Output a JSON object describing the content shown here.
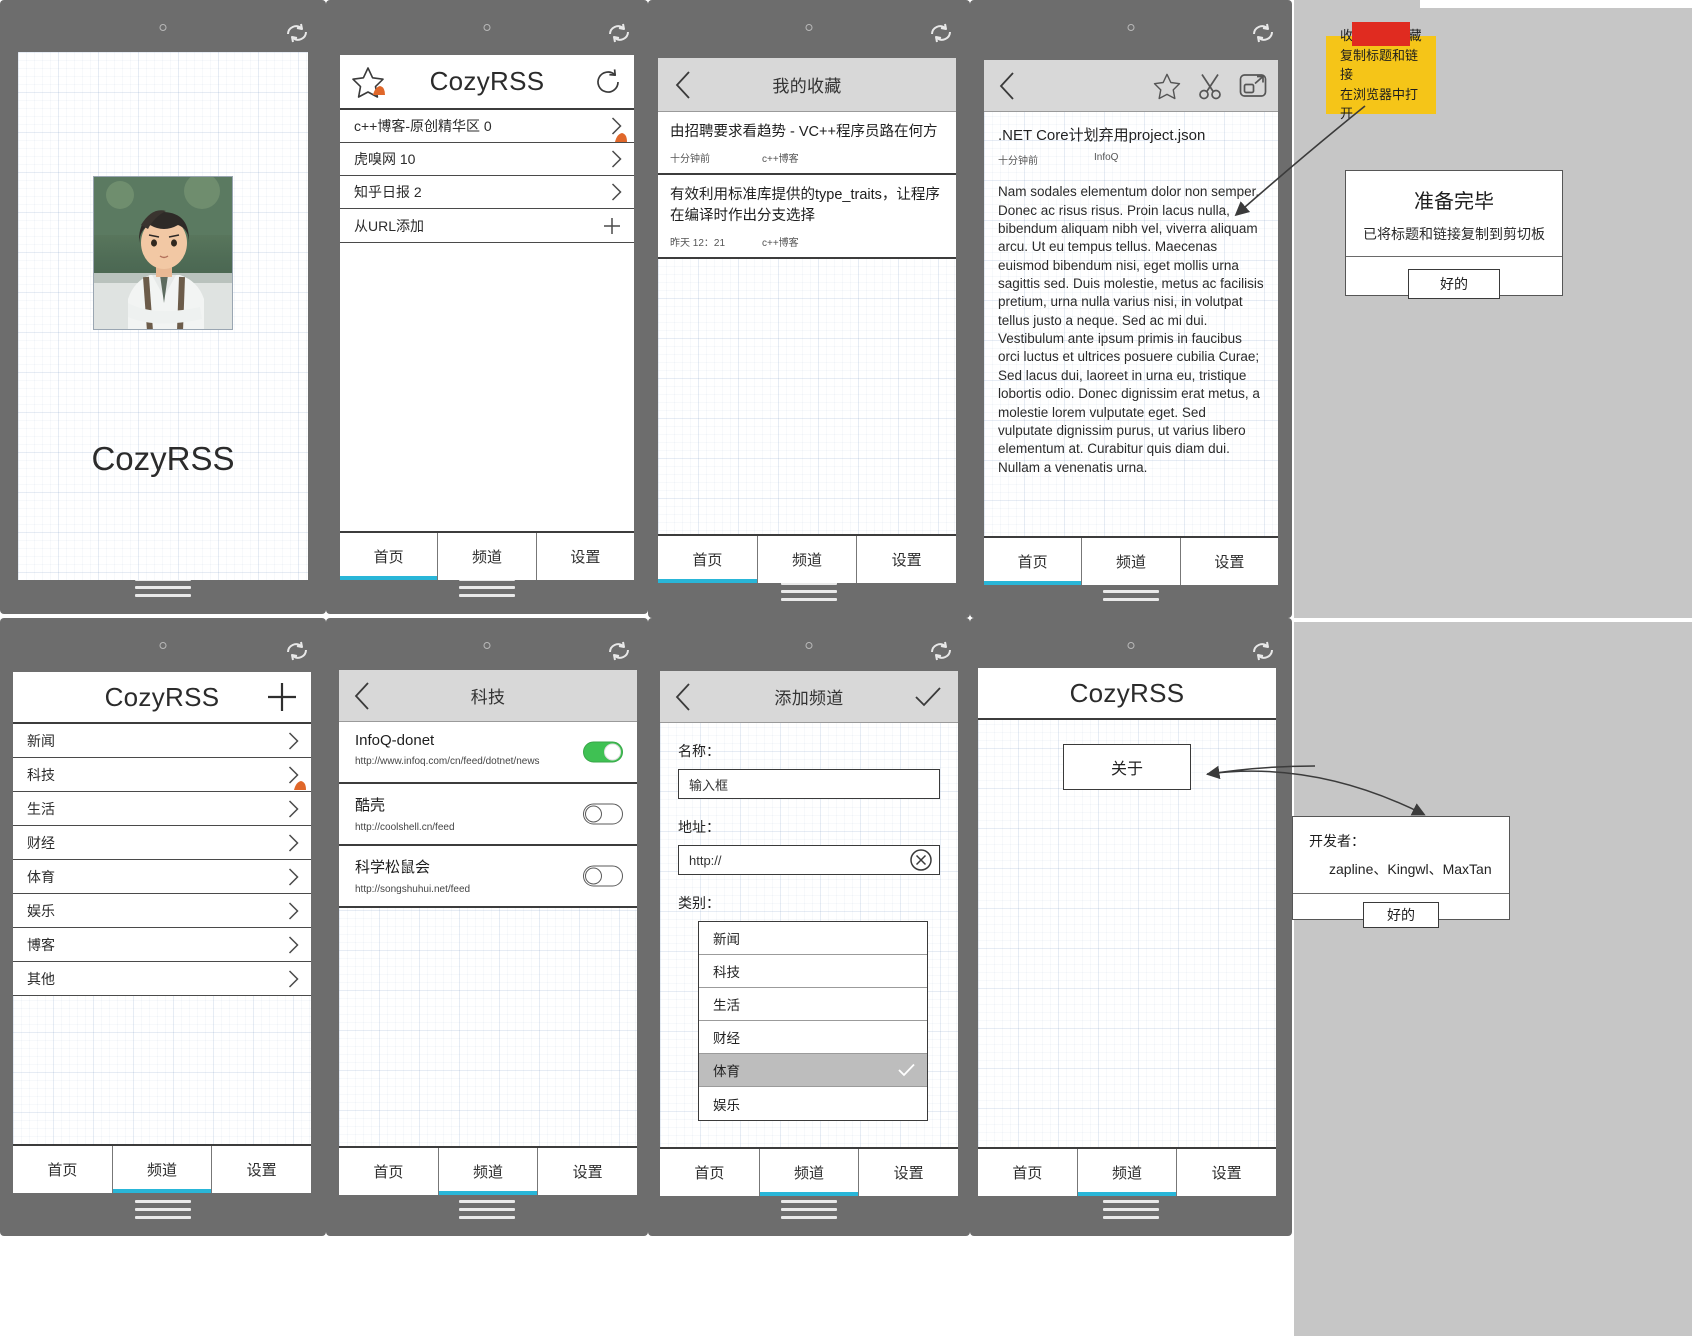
{
  "app": {
    "name": "CozyRSS"
  },
  "screens": {
    "splash": {
      "title": "CozyRSS",
      "image_alt": "anime-character-illustration"
    },
    "home": {
      "title": "CozyRSS",
      "star_icon": "star-icon",
      "refresh_icon": "refresh-icon",
      "feeds": [
        {
          "label": "c++博客-原创精华区 0"
        },
        {
          "label": "虎嗅网 10"
        },
        {
          "label": "知乎日报 2"
        }
      ],
      "add_from_url": "从URL添加",
      "add_icon": "plus-icon"
    },
    "favorites": {
      "title": "我的收藏",
      "back_icon": "chevron-left-icon",
      "items": [
        {
          "title": "由招聘要求看趋势 - VC++程序员路在何方",
          "time": "十分钟前",
          "source": "c++博客"
        },
        {
          "title": "有效利用标准库提供的type_traits，让程序在编译时作出分支选择",
          "time": "昨天 12：21",
          "source": "c++博客"
        }
      ]
    },
    "article": {
      "back_icon": "chevron-left-icon",
      "star_icon": "star-icon",
      "scissors_icon": "scissors-icon",
      "open_browser_icon": "open-in-browser-icon",
      "title": ".NET Core计划弃用project.json",
      "time": "十分钟前",
      "source": "InfoQ",
      "body": "Nam sodales elementum dolor non semper. Donec ac risus risus. Proin lacus nulla, bibendum aliquam nibh vel, viverra aliquam arcu. Ut eu tempus tellus. Maecenas euismod bibendum nisi, eget mollis urna sagittis sed. Duis molestie, metus ac facilisis pretium, urna nulla varius nisi, in volutpat tellus justo a neque. Sed ac mi dui. Vestibulum ante ipsum primis in faucibus orci luctus et ultrices posuere cubilia Curae; Sed lacus dui, laoreet in urna eu, tristique lobortis odio. Donec dignissim erat metus, a molestie lorem vulputate eget. Sed vulputate dignissim purus, ut varius libero elementum at. Curabitur quis diam dui. Nullam a venenatis urna."
    },
    "channels": {
      "title": "CozyRSS",
      "add_icon": "plus-icon",
      "categories": [
        {
          "label": "新闻"
        },
        {
          "label": "科技"
        },
        {
          "label": "生活"
        },
        {
          "label": "财经"
        },
        {
          "label": "体育"
        },
        {
          "label": "娱乐"
        },
        {
          "label": "博客"
        },
        {
          "label": "其他"
        }
      ]
    },
    "category_feeds": {
      "title": "科技",
      "back_icon": "chevron-left-icon",
      "feeds": [
        {
          "name": "InfoQ-donet",
          "url": "http://www.infoq.com/cn/feed/dotnet/news",
          "enabled": true
        },
        {
          "name": "酷壳",
          "url": "http://coolshell.cn/feed",
          "enabled": false
        },
        {
          "name": "科学松鼠会",
          "url": "http://songshuhui.net/feed",
          "enabled": false
        }
      ]
    },
    "add_channel": {
      "title": "添加频道",
      "back_icon": "chevron-left-icon",
      "confirm_icon": "check-icon",
      "name_label": "名称：",
      "name_value": "输入框",
      "url_label": "地址：",
      "url_value": "http://",
      "clear_icon": "clear-circle-icon",
      "category_label": "类别：",
      "category_options": [
        {
          "label": "新闻",
          "selected": false
        },
        {
          "label": "科技",
          "selected": false
        },
        {
          "label": "生活",
          "selected": false
        },
        {
          "label": "财经",
          "selected": false
        },
        {
          "label": "体育",
          "selected": true
        },
        {
          "label": "娱乐",
          "selected": false
        }
      ]
    },
    "settings": {
      "title": "CozyRSS",
      "about_button": "关于"
    }
  },
  "bottom_nav": {
    "tabs": [
      {
        "label": "首页"
      },
      {
        "label": "频道"
      },
      {
        "label": "设置"
      }
    ],
    "accent_color": "#29b6d8"
  },
  "annotations": {
    "sticky_note": {
      "lines": [
        "收藏/取消收藏",
        "复制标题和链接",
        "在浏览器中打开"
      ],
      "bg_color": "#f5c518",
      "tape_color": "#e02b20"
    },
    "clipboard_dialog": {
      "title": "准备完毕",
      "message": "已将标题和链接复制到剪切板",
      "ok_button": "好的"
    },
    "about_dialog": {
      "title": "开发者：",
      "developers": "zapline、Kingwl、MaxTan",
      "ok_button": "好的"
    }
  }
}
